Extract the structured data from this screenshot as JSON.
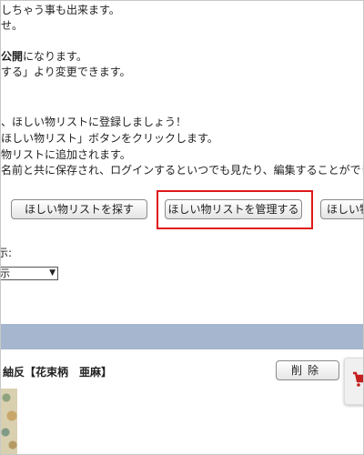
{
  "description": {
    "lines": [
      "しちゃう事も出来ます。",
      "せ。",
      "公開",
      "になります。",
      "する」より変更できます。",
      "、ほしい物リストに登録しましょう！",
      "ほしい物リスト」ボタンをクリックします。",
      "物リストに追加されます。",
      "名前と共に保存され、ログインするといつでも見たり、編集することができます。"
    ]
  },
  "buttons": {
    "search": "ほしい物リストを探す",
    "manage": "ほしい物リストを管理する",
    "third": "ほしい物"
  },
  "display_select": {
    "label": "示:",
    "value": "示"
  },
  "item": {
    "title": "紬反【花束柄　亜麻】",
    "delete_label": "削除"
  },
  "colors": {
    "highlight": "#e01818",
    "section_bar": "#a6b6cf",
    "cart_icon": "#c41f1f"
  }
}
